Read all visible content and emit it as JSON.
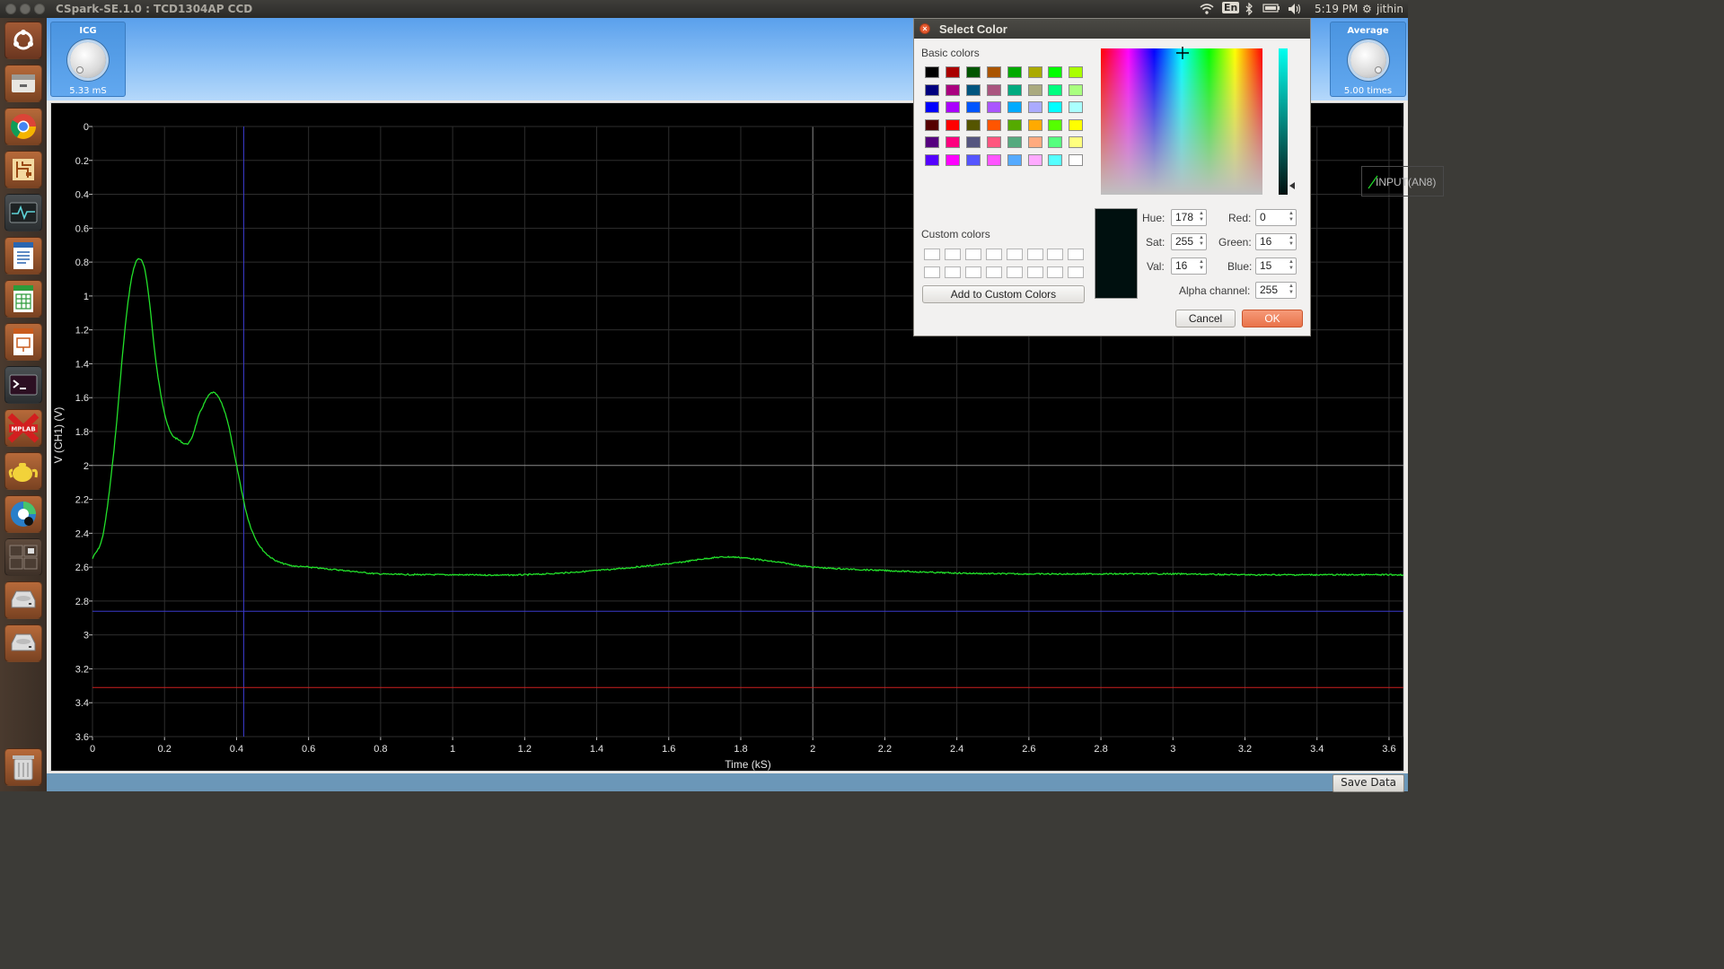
{
  "window": {
    "title": "CSpark-SE.1.0 : TCD1304AP CCD"
  },
  "tray": {
    "lang": "En",
    "time": "5:19 PM",
    "user": "jithin"
  },
  "controls": {
    "icg": {
      "label": "ICG",
      "value": "5.33 mS"
    },
    "average": {
      "label": "Average",
      "value": "5.00  times"
    }
  },
  "legend": {
    "channel": "INPUT(AN8)"
  },
  "statusbar": {
    "save_label": "Save Data"
  },
  "chart_data": {
    "type": "line",
    "xlabel": "Time (kS)",
    "ylabel": "V (CH1) (V)",
    "xlim": [
      0,
      3.64
    ],
    "ylim": [
      0,
      3.6
    ],
    "y_inverted": true,
    "grid": true,
    "x_ticks": [
      "0",
      "0.2",
      "0.4",
      "0.6",
      "0.8",
      "1",
      "1.2",
      "1.4",
      "1.6",
      "1.8",
      "2",
      "2.2",
      "2.4",
      "2.6",
      "2.8",
      "3",
      "3.2",
      "3.4",
      "3.6"
    ],
    "y_ticks": [
      "0",
      "0.2",
      "0.4",
      "0.6",
      "0.8",
      "1",
      "1.2",
      "1.4",
      "1.6",
      "1.8",
      "2",
      "2.2",
      "2.4",
      "2.6",
      "2.8",
      "3",
      "3.2",
      "3.4",
      "3.6"
    ],
    "series": [
      {
        "color": "#22e02a",
        "x": [
          0,
          0.03,
          0.06,
          0.09,
          0.11,
          0.13,
          0.15,
          0.18,
          0.21,
          0.24,
          0.27,
          0.3,
          0.335,
          0.37,
          0.4,
          0.43,
          0.46,
          0.5,
          0.55,
          0.6,
          0.7,
          0.8,
          1.0,
          1.2,
          1.4,
          1.6,
          1.76,
          1.9,
          2.0,
          2.2,
          2.4,
          2.6,
          2.8,
          3.0,
          3.2,
          3.4,
          3.64
        ],
        "y": [
          2.55,
          2.4,
          1.9,
          1.2,
          0.88,
          0.78,
          0.9,
          1.45,
          1.77,
          1.85,
          1.86,
          1.68,
          1.57,
          1.7,
          2.0,
          2.3,
          2.46,
          2.55,
          2.59,
          2.6,
          2.62,
          2.64,
          2.645,
          2.645,
          2.62,
          2.58,
          2.54,
          2.57,
          2.6,
          2.62,
          2.635,
          2.64,
          2.64,
          2.64,
          2.645,
          2.645,
          2.645
        ]
      }
    ],
    "cursors": [
      {
        "orientation": "vertical",
        "x": 0.42,
        "color": "#3a3acc"
      },
      {
        "orientation": "horizontal",
        "y": 2.86,
        "color": "#3a3acc"
      },
      {
        "orientation": "horizontal",
        "y": 3.31,
        "color": "#cc2020"
      }
    ]
  },
  "dialog": {
    "title": "Select Color",
    "basic_colors_label": "Basic colors",
    "basic_colors": [
      "#000000",
      "#aa0000",
      "#005500",
      "#aa5500",
      "#00aa00",
      "#aaaa00",
      "#00ff00",
      "#aaff00",
      "#00007f",
      "#aa007f",
      "#00557f",
      "#aa557f",
      "#00aa7f",
      "#aaaa7f",
      "#00ff7f",
      "#aaff7f",
      "#0000ff",
      "#aa00ff",
      "#0055ff",
      "#aa55ff",
      "#00aaff",
      "#aaaaff",
      "#00ffff",
      "#aaffff",
      "#550000",
      "#ff0000",
      "#555500",
      "#ff5500",
      "#55aa00",
      "#ffaa00",
      "#55ff00",
      "#ffff00",
      "#55007f",
      "#ff007f",
      "#55557f",
      "#ff557f",
      "#55aa7f",
      "#ffaa7f",
      "#55ff7f",
      "#ffff7f",
      "#5500ff",
      "#ff00ff",
      "#5555ff",
      "#ff55ff",
      "#55aaff",
      "#ffaaff",
      "#55ffff",
      "#ffffff"
    ],
    "custom_colors_label": "Custom colors",
    "add_custom_label": "Add to Custom Colors",
    "current_color": "#00100f",
    "fields": {
      "hue": {
        "label": "Hue:",
        "value": "178"
      },
      "sat": {
        "label": "Sat:",
        "value": "255"
      },
      "val": {
        "label": "Val:",
        "value": "16"
      },
      "red": {
        "label": "Red:",
        "value": "0"
      },
      "green": {
        "label": "Green:",
        "value": "16"
      },
      "blue": {
        "label": "Blue:",
        "value": "15"
      },
      "alpha": {
        "label": "Alpha channel:",
        "value": "255"
      }
    },
    "cancel_label": "Cancel",
    "ok_label": "OK"
  }
}
